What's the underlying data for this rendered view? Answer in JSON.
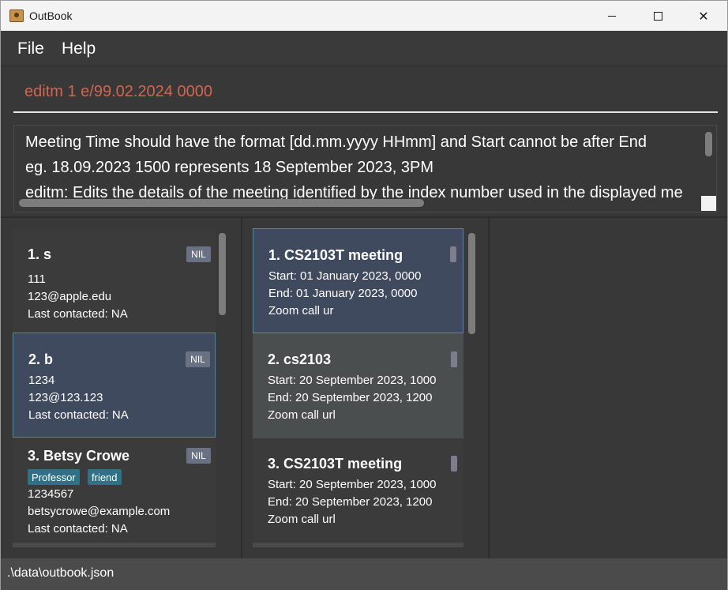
{
  "window": {
    "title": "OutBook"
  },
  "menu": {
    "file": "File",
    "help": "Help"
  },
  "command": {
    "value": "editm 1 e/99.02.2024 0000"
  },
  "result": {
    "lines": [
      "Meeting Time should have the format [dd.mm.yyyy HHmm] and Start cannot be after End",
      "eg. 18.09.2023 1500 represents 18 September 2023, 3PM",
      "editm: Edits the details of the meeting identified by the index number used in the displayed me"
    ]
  },
  "persons": [
    {
      "title": "1.  s",
      "phone": "111",
      "email": "123@apple.edu",
      "last": "Last contacted: NA",
      "badge": "NIL",
      "tags": []
    },
    {
      "title": "2.  b",
      "phone": "1234",
      "email": "123@123.123",
      "last": "Last contacted: NA",
      "badge": "NIL",
      "tags": []
    },
    {
      "title": "3.  Betsy Crowe",
      "phone": "1234567",
      "email": "betsycrowe@example.com",
      "last": "Last contacted: NA",
      "badge": "NIL",
      "tags": [
        "Professor",
        "friend"
      ]
    }
  ],
  "meetings": [
    {
      "title": "1.  CS2103T meeting",
      "start": "Start: 01 January 2023, 0000",
      "end": "End: 01 January 2023, 0000",
      "link": "Zoom call ur"
    },
    {
      "title": "2.  cs2103",
      "start": "Start: 20 September 2023, 1000",
      "end": "End: 20 September 2023, 1200",
      "link": "Zoom call url"
    },
    {
      "title": "3.  CS2103T meeting",
      "start": "Start: 20 September 2023, 1000",
      "end": "End: 20 September 2023, 1200",
      "link": "Zoom call url"
    }
  ],
  "status": {
    "path": ".\\data\\outbook.json"
  },
  "colors": {
    "accent": "#3e8fb0",
    "error_text": "#d06651",
    "tag": "#2f7287",
    "badge": "#697182"
  }
}
